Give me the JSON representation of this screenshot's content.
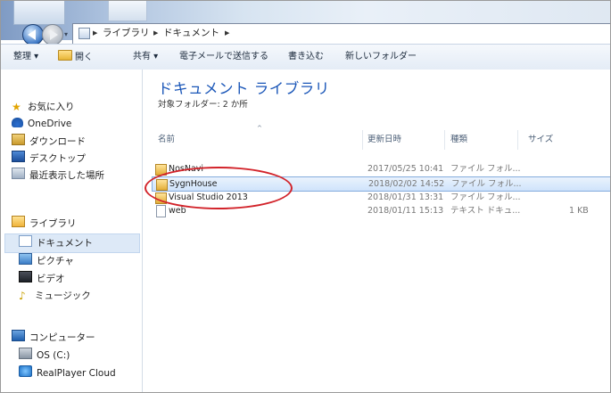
{
  "address": {
    "crumbs": [
      "ライブラリ",
      "ドキュメント"
    ]
  },
  "toolbar": {
    "organize": "整理 ▾",
    "open": "開く",
    "share": "共有 ▾",
    "email": "電子メールで送信する",
    "burn": "書き込む",
    "new_folder": "新しいフォルダー"
  },
  "sidebar": {
    "favorites": "お気に入り",
    "items": [
      {
        "label": "OneDrive",
        "icon": "onedrive-icon"
      },
      {
        "label": "ダウンロード",
        "icon": "downloads-icon"
      },
      {
        "label": "デスクトップ",
        "icon": "desktop-icon"
      },
      {
        "label": "最近表示した場所",
        "icon": "recent-places-icon"
      }
    ],
    "libraries": "ライブラリ",
    "library_items": [
      {
        "label": "ドキュメント",
        "icon": "documents-icon"
      },
      {
        "label": "ピクチャ",
        "icon": "pictures-icon"
      },
      {
        "label": "ビデオ",
        "icon": "videos-icon"
      },
      {
        "label": "ミュージック",
        "icon": "music-icon"
      }
    ],
    "computer": "コンピューター",
    "computer_items": [
      {
        "label": "OS (C:)",
        "icon": "disk-icon"
      },
      {
        "label": "RealPlayer Cloud",
        "icon": "realplayer-icon"
      }
    ]
  },
  "main": {
    "title": "ドキュメント ライブラリ",
    "subtitle": "対象フォルダー: 2 か所",
    "columns": {
      "name": "名前",
      "date": "更新日時",
      "type": "種類",
      "size": "サイズ"
    },
    "rows": [
      {
        "name": "NosNavi",
        "date": "2017/05/25 10:41",
        "type": "ファイル フォル...",
        "size": "",
        "kind": "folder"
      },
      {
        "name": "SygnHouse",
        "date": "2018/02/02 14:52",
        "type": "ファイル フォル...",
        "size": "",
        "kind": "folder"
      },
      {
        "name": "Visual Studio 2013",
        "date": "2018/01/31 13:31",
        "type": "ファイル フォル...",
        "size": "",
        "kind": "folder"
      },
      {
        "name": "web",
        "date": "2018/01/11 15:13",
        "type": "テキスト ドキュ...",
        "size": "1 KB",
        "kind": "file"
      }
    ],
    "selected_row": 1
  },
  "colors": {
    "accent_title": "#1a56b8",
    "selection": "#cfe3fb",
    "annotation_circle": "#d2232a"
  }
}
